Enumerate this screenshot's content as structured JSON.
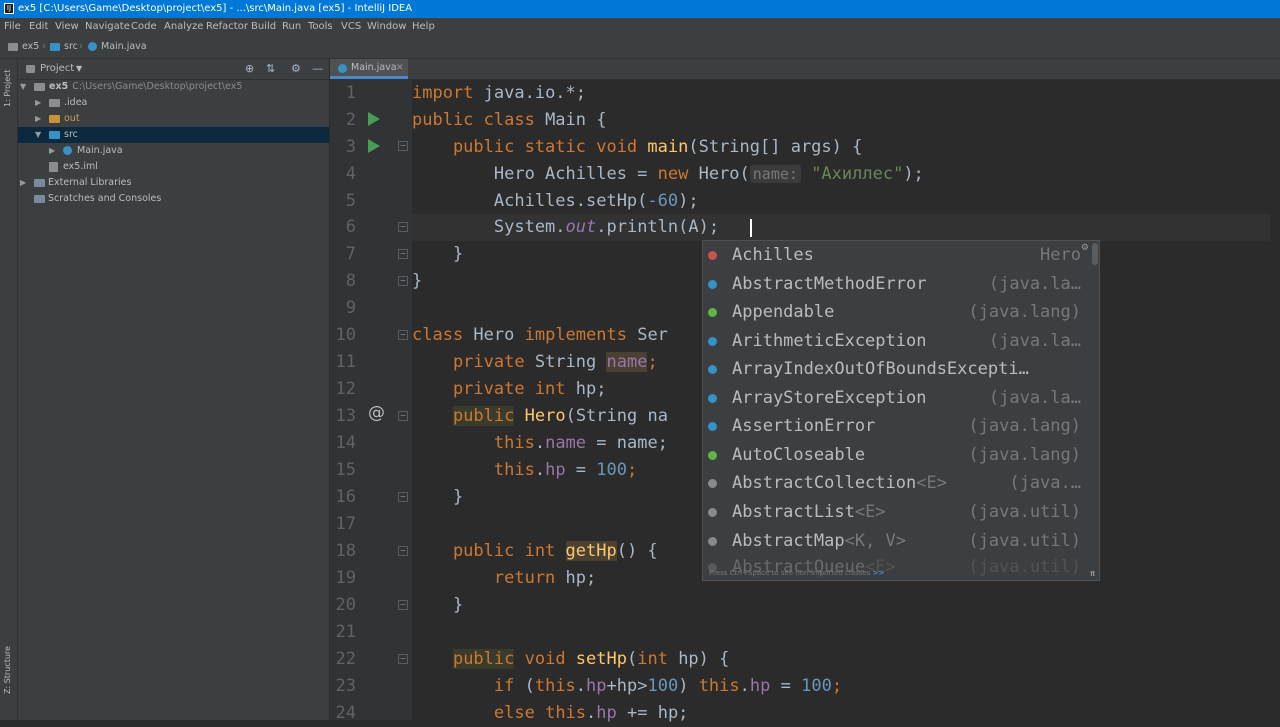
{
  "window": {
    "title": "ex5 [C:\\Users\\Game\\Desktop\\project\\ex5] - ...\\src\\Main.java [ex5] - IntelliJ IDEA"
  },
  "menu": [
    "File",
    "Edit",
    "View",
    "Navigate",
    "Code",
    "Analyze",
    "Refactor",
    "Build",
    "Run",
    "Tools",
    "VCS",
    "Window",
    "Help"
  ],
  "breadcrumb": [
    "ex5",
    "src",
    "Main.java"
  ],
  "left_strip": {
    "project": "1: Project",
    "structure": "Z: Structure"
  },
  "project_panel": {
    "title": "Project",
    "tree": [
      {
        "label": "ex5",
        "path": "C:\\Users\\Game\\Desktop\\project\\ex5"
      },
      {
        "label": ".idea"
      },
      {
        "label": "out"
      },
      {
        "label": "src"
      },
      {
        "label": "Main.java"
      },
      {
        "label": "ex5.iml"
      },
      {
        "label": "External Libraries"
      },
      {
        "label": "Scratches and Consoles"
      }
    ]
  },
  "editor": {
    "tab": "Main.java",
    "line_numbers": [
      "1",
      "2",
      "3",
      "4",
      "5",
      "6",
      "7",
      "8",
      "9",
      "10",
      "11",
      "12",
      "13",
      "14",
      "15",
      "16",
      "17",
      "18",
      "19",
      "20",
      "21",
      "22",
      "23",
      "24"
    ],
    "code": {
      "l1a": "import",
      "l1b": " java.io.*;",
      "l2a": "public class",
      "l2b": " Main {",
      "l3a": "    public static void ",
      "l3b": "main",
      "l3c": "(String[] args) {",
      "l4a": "        Hero Achilles = ",
      "l4b": "new",
      "l4c": " Hero(",
      "l4hint": "name:",
      "l4d": " ",
      "l4e": "\"Ахиллес\"",
      "l4f": ");",
      "l5a": "        Achilles.setHp(",
      "l5b": "-60",
      "l5c": ");",
      "l6a": "        System.",
      "l6b": "out",
      "l6c": ".println(A",
      "l6d": ");",
      "l7": "    }",
      "l8": "}",
      "l10a": "class",
      "l10b": " Hero ",
      "l10c": "implements",
      "l10d": " Ser",
      "l11a": "    private",
      "l11b": " String ",
      "l11c": "name",
      "l11d": ";",
      "l12a": "    private int",
      "l12b": " hp;",
      "l13a": "    ",
      "l13b": "public",
      "l13c": " ",
      "l13d": "Hero",
      "l13e": "(String na",
      "l14a": "        this",
      "l14b": ".",
      "l14c": "name",
      "l14d": " = name;",
      "l15a": "        this",
      "l15b": ".",
      "l15c": "hp",
      "l15d": " = ",
      "l15e": "100",
      "l15f": ";",
      "l16": "    }",
      "l18a": "    public int ",
      "l18b": "getHp",
      "l18c": "() {",
      "l19a": "        return",
      "l19b": " hp;",
      "l20": "    }",
      "l22a": "    ",
      "l22b": "public",
      "l22c": " void ",
      "l22d": "setHp",
      "l22e": "(",
      "l22f": "int",
      "l22g": " hp) {",
      "l23a": "        if",
      "l23b": " (",
      "l23c": "this",
      "l23d": ".",
      "l23e": "hp",
      "l23f": "+hp>",
      "l23g": "100",
      "l23h": ") ",
      "l23i": "this",
      "l23j": ".",
      "l23k": "hp",
      "l23l": " = ",
      "l23m": "100",
      "l23n": ";",
      "l24a": "        else",
      "l24b": " ",
      "l24c": "this",
      "l24d": ".",
      "l24e": "hp",
      "l24f": " += hp;"
    }
  },
  "completion": {
    "items": [
      {
        "name": "Achilles",
        "generic": "",
        "type": "Hero",
        "icon_color": "#c75450"
      },
      {
        "name": "AbstractMethodError",
        "generic": "",
        "type": "(java.la…",
        "icon_color": "#3592c4"
      },
      {
        "name": "Appendable",
        "generic": "",
        "type": "(java.lang)",
        "icon_color": "#62b543"
      },
      {
        "name": "ArithmeticException",
        "generic": "",
        "type": "(java.la…",
        "icon_color": "#3592c4"
      },
      {
        "name": "ArrayIndexOutOfBoundsExcepti…",
        "generic": "",
        "type": "",
        "icon_color": "#3592c4"
      },
      {
        "name": "ArrayStoreException",
        "generic": "",
        "type": "(java.la…",
        "icon_color": "#3592c4"
      },
      {
        "name": "AssertionError",
        "generic": "",
        "type": "(java.lang)",
        "icon_color": "#3592c4"
      },
      {
        "name": "AutoCloseable",
        "generic": "",
        "type": "(java.lang)",
        "icon_color": "#62b543"
      },
      {
        "name": "AbstractCollection",
        "generic": "<E>",
        "type": "(java.…",
        "icon_color": "#8a8a8a"
      },
      {
        "name": "AbstractList",
        "generic": "<E>",
        "type": "(java.util)",
        "icon_color": "#8a8a8a"
      },
      {
        "name": "AbstractMap",
        "generic": "<K, V>",
        "type": "(java.util)",
        "icon_color": "#8a8a8a"
      },
      {
        "name": "AbstractQueue",
        "generic": "<E>",
        "type": "(java.util)",
        "icon_color": "#8a8a8a"
      }
    ],
    "footer_text": "Press Ctrl+Space to see non-imported classes",
    "footer_link": ">>",
    "footer_pi": "π"
  }
}
